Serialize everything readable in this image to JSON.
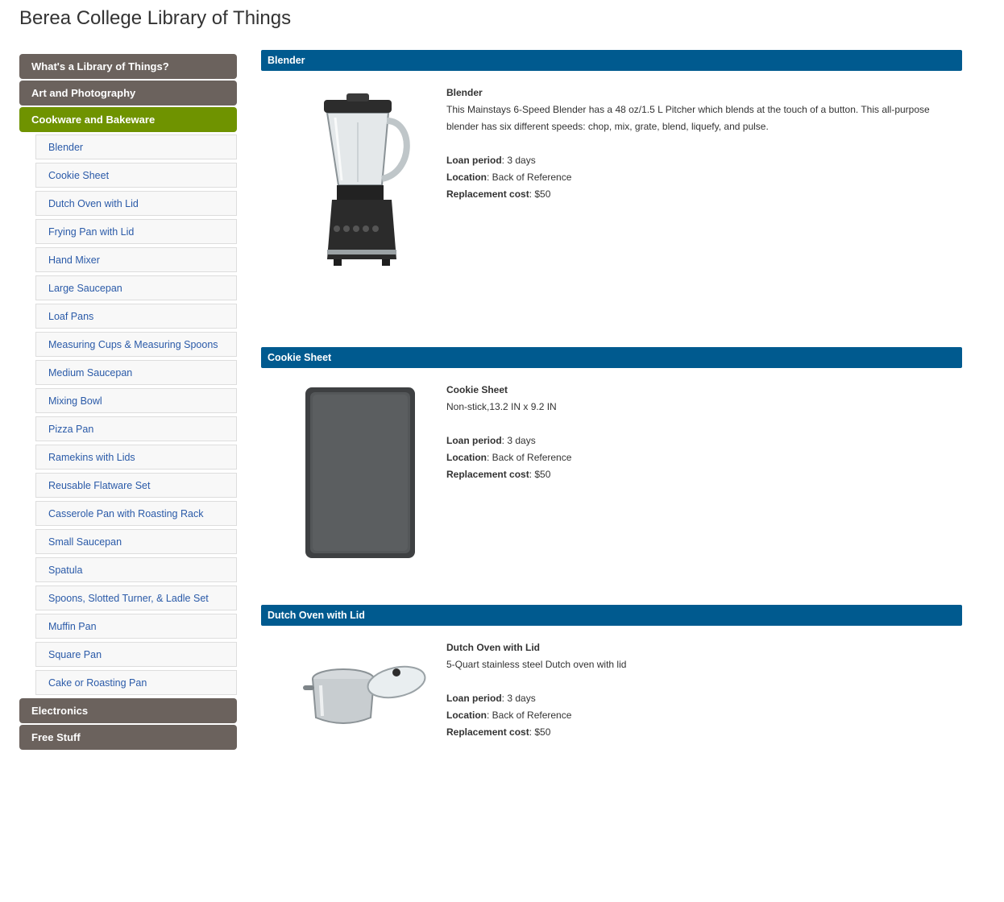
{
  "site": {
    "title": "Berea College Library of Things"
  },
  "sidebar": {
    "categories_top": [
      {
        "label": "What's a Library of Things?"
      },
      {
        "label": "Art and Photography"
      },
      {
        "label": "Cookware and Bakeware"
      }
    ],
    "sub_items": [
      {
        "label": "Blender"
      },
      {
        "label": "Cookie Sheet"
      },
      {
        "label": "Dutch Oven with Lid"
      },
      {
        "label": "Frying Pan with Lid"
      },
      {
        "label": "Hand Mixer"
      },
      {
        "label": "Large Saucepan"
      },
      {
        "label": "Loaf Pans"
      },
      {
        "label": "Measuring Cups & Measuring Spoons"
      },
      {
        "label": "Medium Saucepan"
      },
      {
        "label": "Mixing Bowl"
      },
      {
        "label": "Pizza Pan"
      },
      {
        "label": "Ramekins with Lids"
      },
      {
        "label": "Reusable Flatware Set"
      },
      {
        "label": "Casserole Pan with Roasting Rack"
      },
      {
        "label": "Small Saucepan"
      },
      {
        "label": "Spatula"
      },
      {
        "label": "Spoons, Slotted Turner, & Ladle Set"
      },
      {
        "label": "Muffin Pan"
      },
      {
        "label": "Square Pan"
      },
      {
        "label": "Cake or Roasting Pan"
      }
    ],
    "categories_bottom": [
      {
        "label": "Electronics"
      },
      {
        "label": "Free Stuff"
      }
    ],
    "colors": {
      "category": "#6b625d",
      "active": "#6f9300",
      "link": "#2a5aa8"
    }
  },
  "labels": {
    "loan_period": "Loan period",
    "location": "Location",
    "replacement_cost": "Replacement cost"
  },
  "items": [
    {
      "header": "Blender",
      "name": "Blender",
      "description": "This Mainstays 6-Speed Blender has a 48 oz/1.5 L Pitcher which blends at the touch of a button. This all-purpose blender has six different speeds: chop, mix, grate, blend, liquefy, and pulse.",
      "loan_period": ": 3 days",
      "location": ": Back of Reference",
      "replacement_cost": ": $50",
      "image_icon": "blender-image"
    },
    {
      "header": "Cookie Sheet",
      "name": "Cookie Sheet",
      "description": "Non-stick,13.2 IN x 9.2 IN",
      "loan_period": ": 3 days",
      "location": ": Back of Reference",
      "replacement_cost": ": $50",
      "image_icon": "cookie-sheet-image"
    },
    {
      "header": "Dutch Oven with Lid",
      "name": "Dutch Oven with Lid",
      "description": "5-Quart stainless steel Dutch oven with lid",
      "loan_period": ": 3 days",
      "location": ": Back of Reference",
      "replacement_cost": ": $50",
      "image_icon": "dutch-oven-image"
    }
  ],
  "colors": {
    "header_bar": "#005a8f"
  }
}
